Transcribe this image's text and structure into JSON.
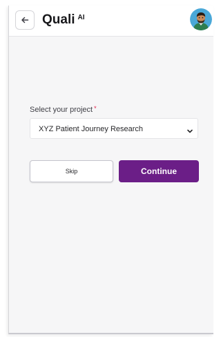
{
  "header": {
    "brand_name": "Quali",
    "brand_suffix": "AI",
    "back_icon": "arrow-left-icon",
    "avatar_icon": "user-avatar"
  },
  "form": {
    "project_label": "Select your project",
    "required_mark": "*",
    "selected_project": "XYZ Patient Journey Research",
    "chevron_icon": "chevron-down-icon"
  },
  "actions": {
    "skip_label": "Skip",
    "continue_label": "Continue"
  },
  "colors": {
    "accent": "#6b1e87",
    "required": "#e11d48",
    "background": "#f6f6f7"
  }
}
